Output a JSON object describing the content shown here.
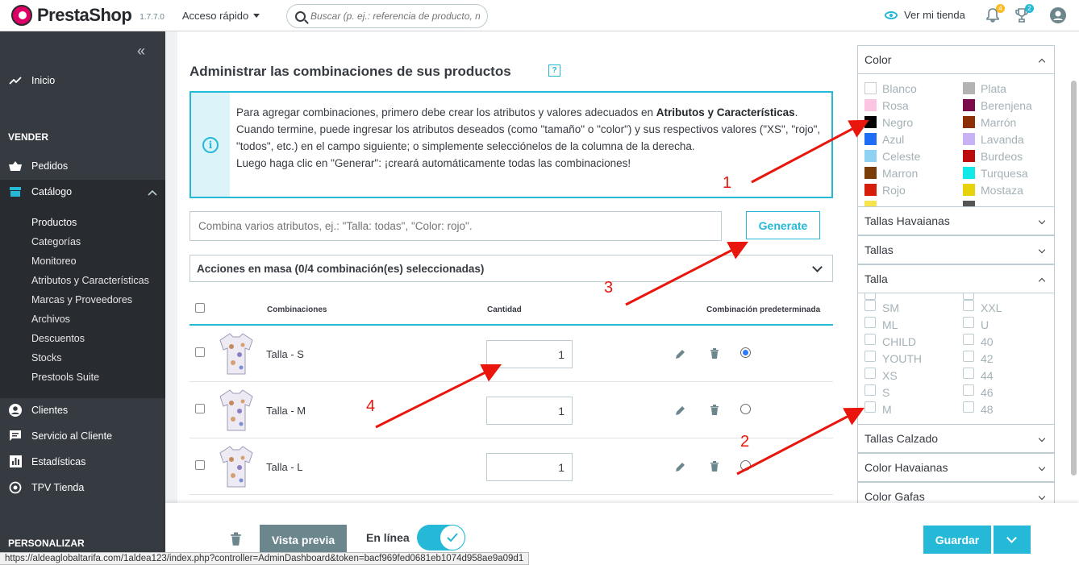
{
  "header": {
    "brand": "PrestaShop",
    "version": "1.7.7.0",
    "quick_access": "Acceso rápido",
    "search_placeholder": "Buscar (p. ej.: referencia de producto, no",
    "view_store": "Ver mi tienda",
    "notif_count": "4",
    "trophy_count": "2"
  },
  "sidebar": {
    "collapse": "«",
    "home": "Inicio",
    "section_sell": "VENDER",
    "orders": "Pedidos",
    "catalog": "Catálogo",
    "catalog_items": [
      "Productos",
      "Categorías",
      "Monitoreo",
      "Atributos y Características",
      "Marcas y Proveedores",
      "Archivos",
      "Descuentos",
      "Stocks",
      "Prestools Suite"
    ],
    "customers": "Clientes",
    "customer_service": "Servicio al Cliente",
    "stats": "Estadísticas",
    "pos": "TPV Tienda",
    "section_customize": "PERSONALIZAR"
  },
  "main": {
    "title": "Administrar las combinaciones de sus productos",
    "help": "?",
    "info_line1": "Para agregar combinaciones, primero debe crear los atributos y valores adecuados en ",
    "info_link": "Atributos y Características",
    "info_line1_end": ".",
    "info_line2": "Cuando termine, puede ingresar los atributos deseados (como \"tamaño\" o \"color\") y sus respectivos valores (\"XS\", \"rojo\", \"todos\", etc.) en el campo siguiente; o simplemente selecciónelos de la columna de la derecha.",
    "info_line3": "Luego haga clic en \"Generar\": ¡creará automáticamente todas las combinaciones!",
    "combine_placeholder": "Combina varios atributos, ej.: \"Talla: todas\", \"Color: rojo\".",
    "generate": "Generate",
    "bulk_actions": "Acciones en masa (0/4 combinación(es) seleccionadas)",
    "col_combinations": "Combinaciones",
    "col_quantity": "Cantidad",
    "col_default": "Combinación predeterminada",
    "rows": [
      {
        "label": "Talla - S",
        "qty": "1",
        "default": true
      },
      {
        "label": "Talla - M",
        "qty": "1",
        "default": false
      },
      {
        "label": "Talla - L",
        "qty": "1",
        "default": false
      }
    ]
  },
  "right_panel": {
    "color_title": "Color",
    "colors_left": [
      {
        "name": "Blanco",
        "hex": "#ffffff"
      },
      {
        "name": "Rosa",
        "hex": "#fcc6e2"
      },
      {
        "name": "Negro",
        "hex": "#000000"
      },
      {
        "name": "Azul",
        "hex": "#1e6ef5"
      },
      {
        "name": "Celeste",
        "hex": "#8fd2f4"
      },
      {
        "name": "Marron",
        "hex": "#7a3d09"
      },
      {
        "name": "Rojo",
        "hex": "#d71e0b"
      }
    ],
    "colors_right": [
      {
        "name": "Plata",
        "hex": "#b3b3b3"
      },
      {
        "name": "Berenjena",
        "hex": "#7a0a49"
      },
      {
        "name": "Marrón",
        "hex": "#8c2e07"
      },
      {
        "name": "Lavanda",
        "hex": "#c6b2f5"
      },
      {
        "name": "Burdeos",
        "hex": "#bc0b0b"
      },
      {
        "name": "Turquesa",
        "hex": "#11e8e8"
      },
      {
        "name": "Mostaza",
        "hex": "#e8d20b"
      }
    ],
    "tallas_havaianas": "Tallas Havaianas",
    "tallas": "Tallas",
    "talla": "Talla",
    "talla_left": [
      "SM",
      "ML",
      "CHILD",
      "YOUTH",
      "XS",
      "S",
      "M"
    ],
    "talla_right": [
      "XXL",
      "U",
      "40",
      "42",
      "44",
      "46",
      "48"
    ],
    "tallas_calzado": "Tallas Calzado",
    "color_havaianas": "Color Havaianas",
    "color_gafas": "Color Gafas"
  },
  "footer": {
    "preview": "Vista previa",
    "online": "En línea",
    "save": "Guardar"
  },
  "status_url": "https://aldeaglobaltarifa.com/1aldea123/index.php?controller=AdminDashboard&token=bacf969fed0681eb1074d958ae9a09d1",
  "annotations": [
    "1",
    "2",
    "3",
    "4"
  ],
  "colors": {
    "accent": "#25b9d7",
    "sidebar": "#363a41",
    "arrow": "#e8160c"
  }
}
